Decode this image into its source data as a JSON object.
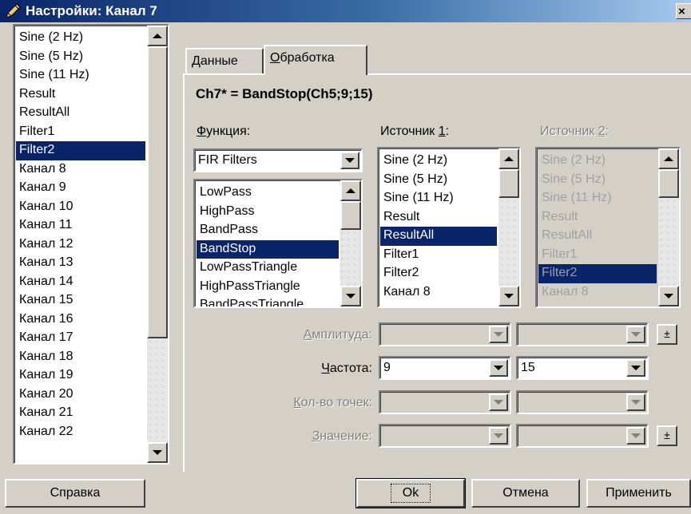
{
  "window": {
    "title": "Настройки: Канал 7",
    "close_label": "×"
  },
  "channel_list": {
    "items": [
      "Sine (2 Hz)",
      "Sine (5 Hz)",
      "Sine (11 Hz)",
      "Result",
      "ResultAll",
      "Filter1",
      "Filter2",
      "Канал 8",
      "Канал 9",
      "Канал 10",
      "Канал 11",
      "Канал 12",
      "Канал 13",
      "Канал 14",
      "Канал 15",
      "Канал 16",
      "Канал 17",
      "Канал 18",
      "Канал 19",
      "Канал 20",
      "Канал 21",
      "Канал 22"
    ],
    "selected": "Filter2"
  },
  "tabs": [
    {
      "label_underlined": "Д",
      "label_rest": "анные",
      "active": false
    },
    {
      "label_underlined": "О",
      "label_rest": "бработка",
      "active": true
    }
  ],
  "formula": "Ch7* = BandStop(Ch5;9;15)",
  "function": {
    "label_underlined": "Ф",
    "label_rest": "ункция:",
    "category": "FIR Filters",
    "items": [
      "LowPass",
      "HighPass",
      "BandPass",
      "BandStop",
      "LowPassTriangle",
      "HighPassTriangle",
      "BandPassTriangle"
    ],
    "selected": "BandStop"
  },
  "source1": {
    "label_prefix": "Источник ",
    "label_underlined": "1",
    "label_suffix": ":",
    "items": [
      "Sine (2 Hz)",
      "Sine (5 Hz)",
      "Sine (11 Hz)",
      "Result",
      "ResultAll",
      "Filter1",
      "Filter2",
      "Канал 8"
    ],
    "selected": "ResultAll"
  },
  "source2": {
    "label_prefix": "Источник ",
    "label_underlined": "2",
    "label_suffix": ":",
    "items": [
      "Sine (2 Hz)",
      "Sine (5 Hz)",
      "Sine (11 Hz)",
      "Result",
      "ResultAll",
      "Filter1",
      "Filter2",
      "Канал 8"
    ],
    "selected": "Filter2"
  },
  "params": {
    "amplitude": {
      "label_underlined": "А",
      "label_rest": "мплитуда:",
      "value1": "",
      "value2": ""
    },
    "frequency": {
      "label_underlined": "Ч",
      "label_rest": "астота:",
      "value1": "9",
      "value2": "15"
    },
    "points": {
      "label_underlined": "К",
      "label_rest": "ол-во точек:",
      "value1": "",
      "value2": ""
    },
    "value": {
      "label_underlined": "З",
      "label_rest": "начение:",
      "value1": "",
      "value2": ""
    },
    "plusminus_label": "±"
  },
  "buttons": {
    "help": "Справка",
    "ok": "Ok",
    "cancel": "Отмена",
    "apply": "Применить"
  }
}
